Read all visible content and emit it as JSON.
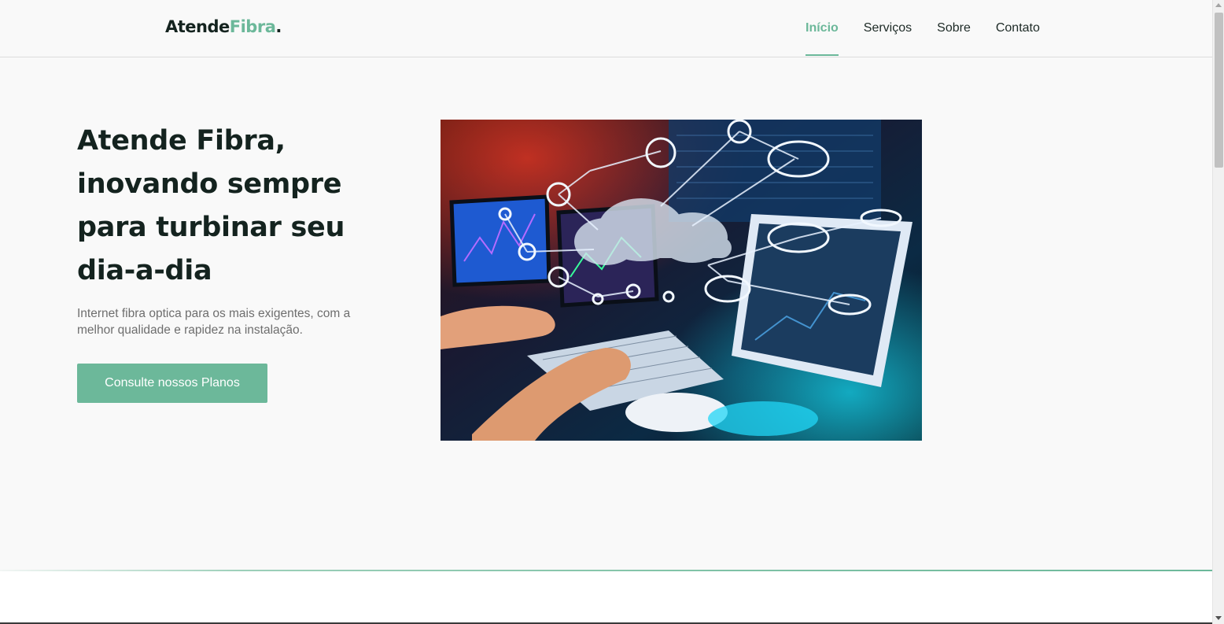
{
  "header": {
    "logo_main": "Atende",
    "logo_accent": "Fibra",
    "logo_dot": ".",
    "nav": [
      {
        "label": "Início",
        "active": true
      },
      {
        "label": "Serviços",
        "active": false
      },
      {
        "label": "Sobre",
        "active": false
      },
      {
        "label": "Contato",
        "active": false
      }
    ]
  },
  "hero": {
    "title_lines": [
      "Atende Fibra,",
      "inovando sempre",
      "para turbinar seu",
      "dia-a-dia"
    ],
    "description": "Internet fibra optica para os mais exigentes, com a melhor qualidade e rapidez na instalação.",
    "cta_label": "Consulte nossos Planos",
    "image_icon": "cloud-network-icon"
  },
  "colors": {
    "accent": "#6cb89a",
    "heading": "#14231f",
    "text_muted": "#6e6e6e",
    "background": "#f9f9f9"
  }
}
